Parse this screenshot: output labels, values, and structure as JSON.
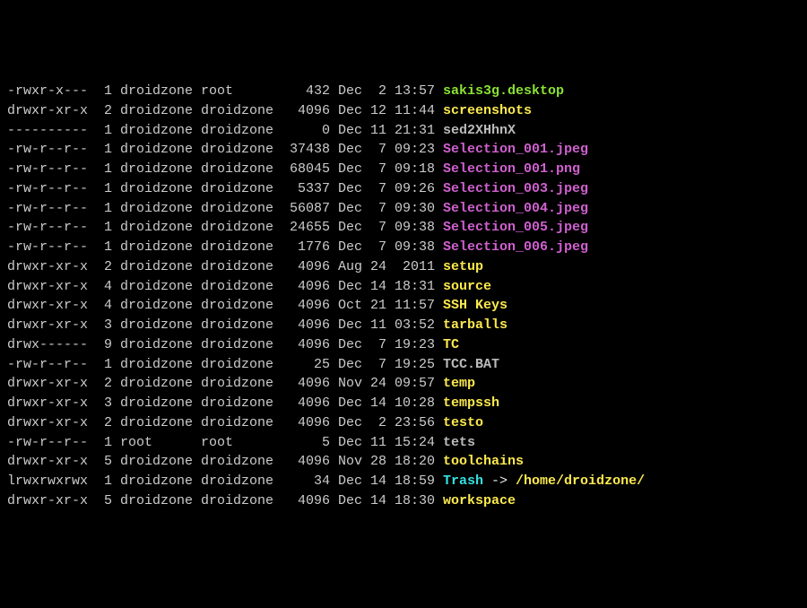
{
  "listing": [
    {
      "perm": "-rwxr-x---",
      "links": 1,
      "owner": "droidzone",
      "group": "root",
      "size": 432,
      "month": "Dec",
      "day": 2,
      "time": "13:57",
      "name": "sakis3g.desktop",
      "cls": "c-green"
    },
    {
      "perm": "drwxr-xr-x",
      "links": 2,
      "owner": "droidzone",
      "group": "droidzone",
      "size": 4096,
      "month": "Dec",
      "day": 12,
      "time": "11:44",
      "name": "screenshots",
      "cls": "c-yellow"
    },
    {
      "perm": "----------",
      "links": 1,
      "owner": "droidzone",
      "group": "droidzone",
      "size": 0,
      "month": "Dec",
      "day": 11,
      "time": "21:31",
      "name": "sed2XHhnX",
      "cls": "c-grey"
    },
    {
      "perm": "-rw-r--r--",
      "links": 1,
      "owner": "droidzone",
      "group": "droidzone",
      "size": 37438,
      "month": "Dec",
      "day": 7,
      "time": "09:23",
      "name": "Selection_001.jpeg",
      "cls": "c-magenta"
    },
    {
      "perm": "-rw-r--r--",
      "links": 1,
      "owner": "droidzone",
      "group": "droidzone",
      "size": 68045,
      "month": "Dec",
      "day": 7,
      "time": "09:18",
      "name": "Selection_001.png",
      "cls": "c-magenta"
    },
    {
      "perm": "-rw-r--r--",
      "links": 1,
      "owner": "droidzone",
      "group": "droidzone",
      "size": 5337,
      "month": "Dec",
      "day": 7,
      "time": "09:26",
      "name": "Selection_003.jpeg",
      "cls": "c-magenta"
    },
    {
      "perm": "-rw-r--r--",
      "links": 1,
      "owner": "droidzone",
      "group": "droidzone",
      "size": 56087,
      "month": "Dec",
      "day": 7,
      "time": "09:30",
      "name": "Selection_004.jpeg",
      "cls": "c-magenta"
    },
    {
      "perm": "-rw-r--r--",
      "links": 1,
      "owner": "droidzone",
      "group": "droidzone",
      "size": 24655,
      "month": "Dec",
      "day": 7,
      "time": "09:38",
      "name": "Selection_005.jpeg",
      "cls": "c-magenta"
    },
    {
      "perm": "-rw-r--r--",
      "links": 1,
      "owner": "droidzone",
      "group": "droidzone",
      "size": 1776,
      "month": "Dec",
      "day": 7,
      "time": "09:38",
      "name": "Selection_006.jpeg",
      "cls": "c-magenta"
    },
    {
      "perm": "drwxr-xr-x",
      "links": 2,
      "owner": "droidzone",
      "group": "droidzone",
      "size": 4096,
      "month": "Aug",
      "day": 24,
      "time": "2011",
      "name": "setup",
      "cls": "c-yellow"
    },
    {
      "perm": "drwxr-xr-x",
      "links": 4,
      "owner": "droidzone",
      "group": "droidzone",
      "size": 4096,
      "month": "Dec",
      "day": 14,
      "time": "18:31",
      "name": "source",
      "cls": "c-yellow"
    },
    {
      "perm": "drwxr-xr-x",
      "links": 4,
      "owner": "droidzone",
      "group": "droidzone",
      "size": 4096,
      "month": "Oct",
      "day": 21,
      "time": "11:57",
      "name": "SSH Keys",
      "cls": "c-yellow"
    },
    {
      "perm": "drwxr-xr-x",
      "links": 3,
      "owner": "droidzone",
      "group": "droidzone",
      "size": 4096,
      "month": "Dec",
      "day": 11,
      "time": "03:52",
      "name": "tarballs",
      "cls": "c-yellow"
    },
    {
      "perm": "drwx------",
      "links": 9,
      "owner": "droidzone",
      "group": "droidzone",
      "size": 4096,
      "month": "Dec",
      "day": 7,
      "time": "19:23",
      "name": "TC",
      "cls": "c-yellow"
    },
    {
      "perm": "-rw-r--r--",
      "links": 1,
      "owner": "droidzone",
      "group": "droidzone",
      "size": 25,
      "month": "Dec",
      "day": 7,
      "time": "19:25",
      "name": "TCC.BAT",
      "cls": "c-grey"
    },
    {
      "perm": "drwxr-xr-x",
      "links": 2,
      "owner": "droidzone",
      "group": "droidzone",
      "size": 4096,
      "month": "Nov",
      "day": 24,
      "time": "09:57",
      "name": "temp",
      "cls": "c-yellow"
    },
    {
      "perm": "drwxr-xr-x",
      "links": 3,
      "owner": "droidzone",
      "group": "droidzone",
      "size": 4096,
      "month": "Dec",
      "day": 14,
      "time": "10:28",
      "name": "tempssh",
      "cls": "c-yellow"
    },
    {
      "perm": "drwxr-xr-x",
      "links": 2,
      "owner": "droidzone",
      "group": "droidzone",
      "size": 4096,
      "month": "Dec",
      "day": 2,
      "time": "23:56",
      "name": "testo",
      "cls": "c-yellow"
    },
    {
      "perm": "-rw-r--r--",
      "links": 1,
      "owner": "root",
      "group": "root",
      "size": 5,
      "month": "Dec",
      "day": 11,
      "time": "15:24",
      "name": "tets",
      "cls": "c-grey"
    },
    {
      "perm": "drwxr-xr-x",
      "links": 5,
      "owner": "droidzone",
      "group": "droidzone",
      "size": 4096,
      "month": "Nov",
      "day": 28,
      "time": "18:20",
      "name": "toolchains",
      "cls": "c-yellow"
    },
    {
      "perm": "lrwxrwxrwx",
      "links": 1,
      "owner": "droidzone",
      "group": "droidzone",
      "size": 34,
      "month": "Dec",
      "day": 14,
      "time": "18:59",
      "name": "Trash",
      "cls": "c-cyan",
      "arrow": " -> ",
      "target": "/home/droidzone/",
      "tcls": "c-yellow"
    },
    {
      "perm": "drwxr-xr-x",
      "links": 5,
      "owner": "droidzone",
      "group": "droidzone",
      "size": 4096,
      "month": "Dec",
      "day": 14,
      "time": "18:30",
      "name": "workspace",
      "cls": "c-yellow"
    }
  ]
}
